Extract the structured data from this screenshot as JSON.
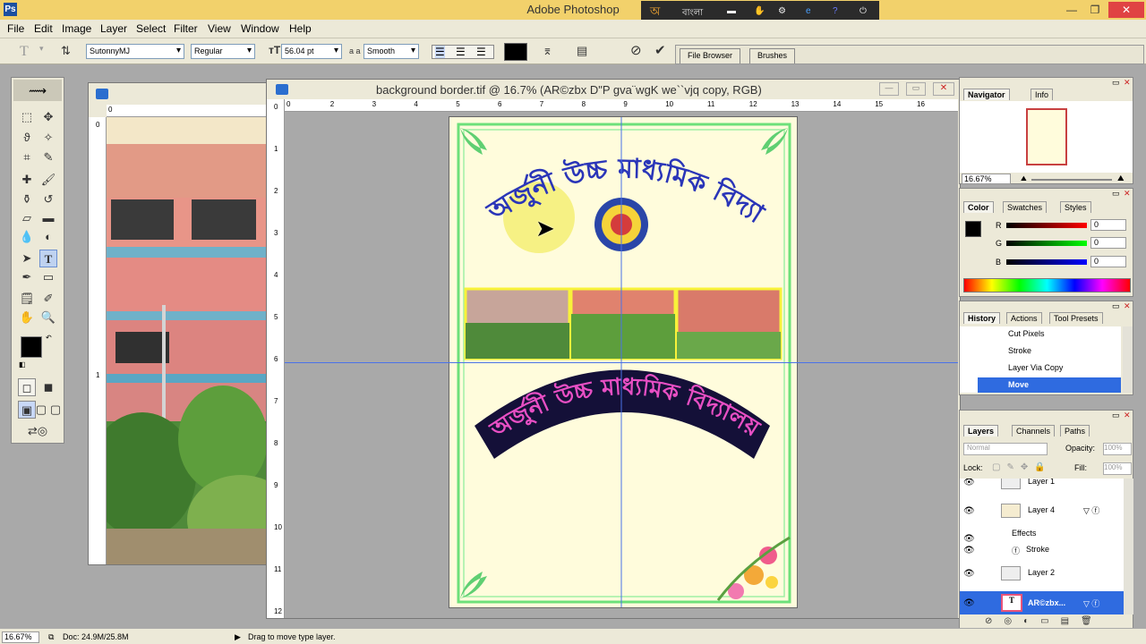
{
  "window": {
    "title": "Adobe Photoshop",
    "lang_label": "বাংলা"
  },
  "menu": [
    "File",
    "Edit",
    "Image",
    "Layer",
    "Select",
    "Filter",
    "View",
    "Window",
    "Help"
  ],
  "options": {
    "font_family": "SutonnyMJ",
    "font_style": "Regular",
    "font_size": "56.04 pt",
    "aa_prefix": "a a",
    "antialias": "Smooth",
    "file_browser_tab": "File Browser",
    "brushes_tab": "Brushes"
  },
  "document": {
    "title": "background border.tif @ 16.7% (AR©zbx D\"P gva¨wgK we``vjq copy, RGB)",
    "h_ruler": [
      "0",
      "2",
      "3",
      "4",
      "5",
      "6",
      "7",
      "8",
      "9",
      "10",
      "11",
      "12",
      "13",
      "14",
      "15",
      "16"
    ],
    "v_ruler": [
      "0",
      "1",
      "2",
      "3",
      "4",
      "5",
      "6",
      "7",
      "8",
      "9",
      "10",
      "11",
      "12"
    ],
    "side_ruler_h": [
      "0",
      "1"
    ],
    "side_ruler_v": [
      "0",
      "1"
    ]
  },
  "artwork": {
    "title_arc": "অর্জুনী উচ্চ মাধ্যমিক বিদ্যালয়",
    "banner_text": "অর্জুনী উচ্চ মাধ্যমিক বিদ্যালয়"
  },
  "navigator": {
    "tab_navigator": "Navigator",
    "tab_info": "Info",
    "zoom": "16.67%"
  },
  "color": {
    "tab_color": "Color",
    "tab_swatches": "Swatches",
    "tab_styles": "Styles",
    "r_label": "R",
    "g_label": "G",
    "b_label": "B",
    "r_value": "0",
    "g_value": "0",
    "b_value": "0",
    "fg": "#000000",
    "bg": "#40d8e0"
  },
  "history": {
    "tab_history": "History",
    "tab_actions": "Actions",
    "tab_tool_presets": "Tool Presets",
    "items": [
      "Cut Pixels",
      "Stroke",
      "Layer Via Copy",
      "Move"
    ]
  },
  "layers": {
    "tab_layers": "Layers",
    "tab_channels": "Channels",
    "tab_paths": "Paths",
    "blend_mode": "Normal",
    "opacity_label": "Opacity:",
    "opacity": "100%",
    "lock_label": "Lock:",
    "fill_label": "Fill:",
    "fill": "100%",
    "rows": [
      "Layer 1",
      "Layer 4",
      "Effects",
      "Stroke",
      "Layer 2",
      "AR©zbx..."
    ]
  },
  "status": {
    "zoom": "16.67%",
    "doc": "Doc: 24.9M/25.8M",
    "hint": "Drag to move type layer."
  }
}
